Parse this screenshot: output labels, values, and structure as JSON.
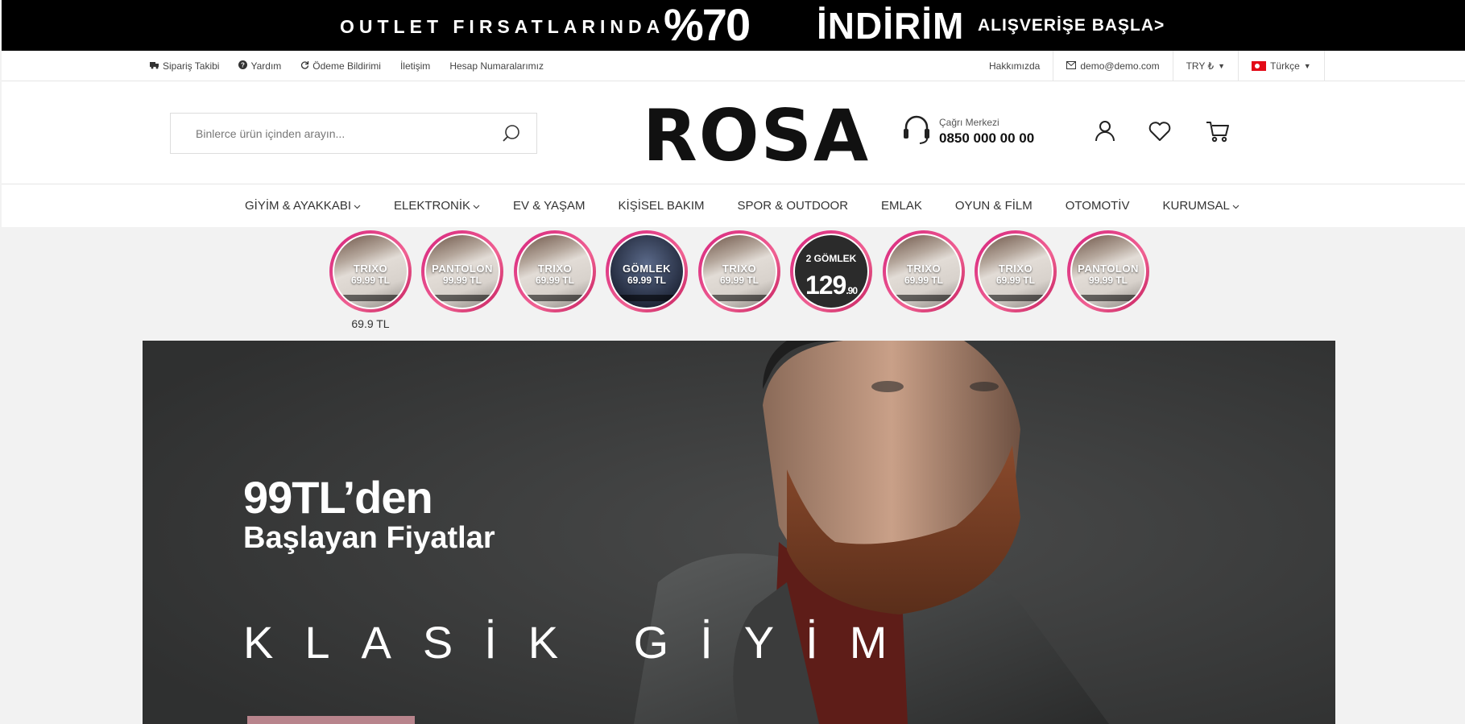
{
  "promo": {
    "text": "OUTLET FIRSATLARINDA",
    "percent": "%70",
    "discount": "İNDİRİM",
    "cta": "ALIŞVERİŞE BAŞLA>"
  },
  "utility": {
    "left": [
      "Sipariş Takibi",
      "Yardım",
      "Ödeme Bildirimi",
      "İletişim",
      "Hesap Numaralarımız"
    ],
    "about": "Hakkımızda",
    "email": "demo@demo.com",
    "currency": "TRY ₺",
    "language": "Türkçe"
  },
  "header": {
    "search_placeholder": "Binlerce ürün içinden arayın...",
    "logo": "ROSA",
    "call_label": "Çağrı Merkezi",
    "call_number": "0850 000 00 00"
  },
  "nav": [
    "GİYİM & AYAKKABI",
    "ELEKTRONİK",
    "EV & YAŞAM",
    "KİŞİSEL BAKIM",
    "SPOR & OUTDOOR",
    "EMLAK",
    "OYUN & FİLM",
    "OTOMOTİV",
    "KURUMSAL"
  ],
  "stories": [
    {
      "title": "TRIXO",
      "price": "69.99 TL"
    },
    {
      "title": "PANTOLON",
      "price": "99.99 TL"
    },
    {
      "title": "TRIXO",
      "price": "69.99 TL"
    },
    {
      "title": "GÖMLEK",
      "price": "69.99 TL"
    },
    {
      "title": "TRIXO",
      "price": "69.99 TL"
    },
    {
      "title": "2 GÖMLEK",
      "price": "129",
      "price_dec": ".90"
    },
    {
      "title": "TRIXO",
      "price": "69.99 TL"
    },
    {
      "title": "TRIXO",
      "price": "69.99 TL"
    },
    {
      "title": "PANTOLON",
      "price": "99.99 TL"
    }
  ],
  "story_price": "69.9 TL",
  "hero": {
    "line1": "99TL’den",
    "line2": "Başlayan Fiyatlar",
    "line3": "KLASİK GİYİM"
  }
}
